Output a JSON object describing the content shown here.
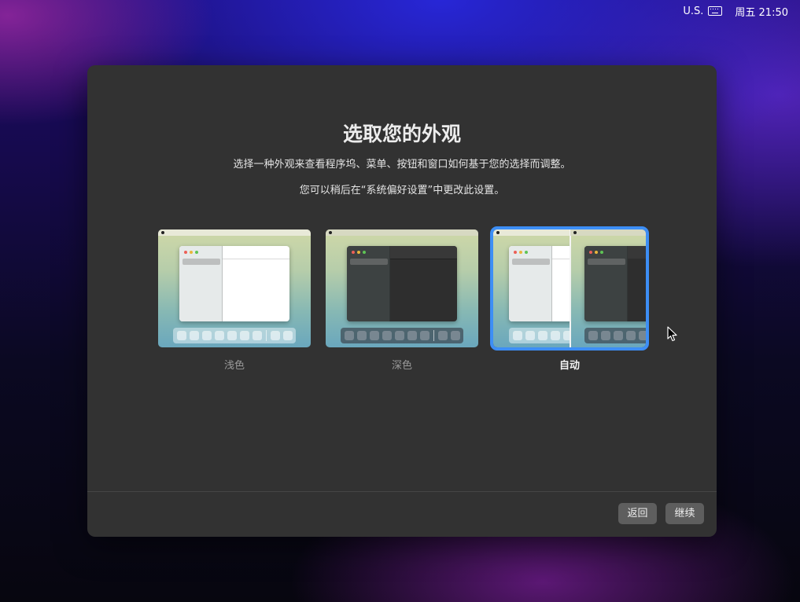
{
  "menubar": {
    "input_source": "U.S.",
    "keyboard_icon": "keyboard-icon",
    "clock": "周五 21:50"
  },
  "setup": {
    "title": "选取您的外观",
    "description": "选择一种外观来查看程序坞、菜单、按钮和窗口如何基于您的选择而调整。",
    "note": "您可以稍后在“系统偏好设置”中更改此设置。",
    "options": [
      {
        "label": "浅色",
        "selected": false
      },
      {
        "label": "深色",
        "selected": false
      },
      {
        "label": "自动",
        "selected": true
      }
    ],
    "accent_color": "#3d8ef5"
  },
  "buttons": {
    "back_label": "返回",
    "continue_label": "继续"
  }
}
